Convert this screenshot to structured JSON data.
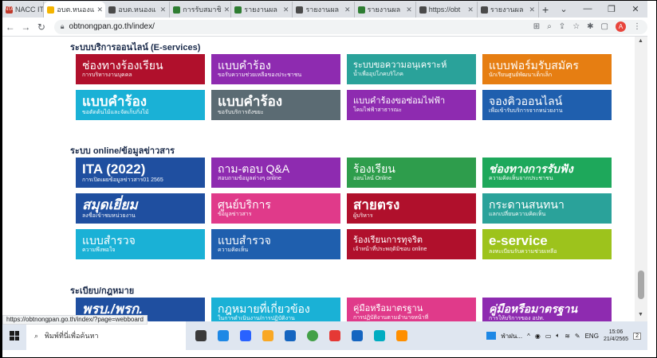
{
  "browser": {
    "tabs": [
      {
        "label": "NACC ITA",
        "favicon_color": "#c0392b",
        "favicon_text": "NTA",
        "active": false
      },
      {
        "label": "อบต.หนองแ",
        "favicon_color": "#f4b400",
        "favicon_text": "",
        "active": true
      },
      {
        "label": "อบต.หนองแ",
        "favicon_color": "#4a4a4a",
        "favicon_text": "",
        "active": false
      },
      {
        "label": "การรับสมาชิ",
        "favicon_color": "#2e7d32",
        "favicon_text": "",
        "active": false
      },
      {
        "label": "รายงานผล",
        "favicon_color": "#2e7d32",
        "favicon_text": "",
        "active": false
      },
      {
        "label": "รายงานผล",
        "favicon_color": "#4a4a4a",
        "favicon_text": "",
        "active": false
      },
      {
        "label": "รายงานผล",
        "favicon_color": "#2e7d32",
        "favicon_text": "",
        "active": false
      },
      {
        "label": "https://obt",
        "favicon_color": "#4a4a4a",
        "favicon_text": "",
        "active": false
      },
      {
        "label": "รายงานผล",
        "favicon_color": "#4a4a4a",
        "favicon_text": "",
        "active": false
      }
    ],
    "url": "obtnongpan.go.th/index/",
    "profile_initial": "A",
    "status_url": "https://obtnongpan.go.th/index/?page=webboard"
  },
  "sections": [
    {
      "title": "ระบบบริการออนไลน์ (E-services)",
      "tiles": [
        {
          "title": "ช่องทางร้องเรียน",
          "subtitle": "การบริหารงานบุคคล",
          "color": "#b0102c",
          "style": ""
        },
        {
          "title": "แบบคำร้อง",
          "subtitle": "ขอรับความช่วยเหลือของประชาชน",
          "color": "#8e2bb0",
          "style": ""
        },
        {
          "title": "ระบบขอความอนุเคราะห์",
          "subtitle": "น้ำเพื่ออุปโภคบริโภค",
          "color": "#2aa29a",
          "style": "small1"
        },
        {
          "title": "แบบฟอร์มรับสมัคร",
          "subtitle": "นักเรียนศูนย์พัฒนาเด็กเล็ก",
          "color": "#e67e12",
          "style": ""
        },
        {
          "title": "แบบคำร้อง",
          "subtitle": "ขอตัดต้นไม้และจัดเก็บกิ่งไม้",
          "color": "#1ab1d6",
          "style": "big"
        },
        {
          "title": "แบบคำร้อง",
          "subtitle": "ขอรับบริการถังขยะ",
          "color": "#5b6b73",
          "style": "big"
        },
        {
          "title": "แบบคำร้องขอซ่อมไฟฟ้า",
          "subtitle": "โคมไฟฟ้าสาธารณะ",
          "color": "#8e2bb0",
          "style": "small1"
        },
        {
          "title": "จองคิวออนไลน์",
          "subtitle": "เพื่อเข้ารับบริการจากหน่วยงาน",
          "color": "#1f5fae",
          "style": ""
        }
      ]
    },
    {
      "title": "ระบบ online/ข้อมูลข่าวสาร",
      "tiles": [
        {
          "title": "ITA (2022)",
          "subtitle": "การเปิดเผยข้อมูลข่าวสาร01 2565",
          "color": "#1f4fa0",
          "style": "big"
        },
        {
          "title": "ถาม-ตอบ Q&A",
          "subtitle": "สอบถามข้อมูลต่างๆ online",
          "color": "#8e2bb0",
          "style": ""
        },
        {
          "title": "ร้องเรียน",
          "subtitle": "ออนไลน์ Online",
          "color": "#2e9d4c",
          "style": ""
        },
        {
          "title": "ช่องทางการรับฟัง",
          "subtitle": "ความคิดเห็นจากประชาชน",
          "color": "#1ea85b",
          "style": "italic"
        },
        {
          "title": "สมุดเยี่ยม",
          "subtitle": "ลงชื่อเข้าชมหน่วยงาน",
          "color": "#1f4fa0",
          "style": "big italic"
        },
        {
          "title": "ศูนย์บริการ",
          "subtitle": "ข้อมูลข่าวสาร",
          "color": "#e03a8a",
          "style": ""
        },
        {
          "title": "สายตรง",
          "subtitle": "ผู้บริหาร",
          "color": "#b0102c",
          "style": "big"
        },
        {
          "title": "กระดานสนทนา",
          "subtitle": "แลกเปลี่ยนความคิดเห็น",
          "color": "#2aa29a",
          "style": ""
        },
        {
          "title": "แบบสำรวจ",
          "subtitle": "ความพึงพอใจ",
          "color": "#1ab1d6",
          "style": ""
        },
        {
          "title": "แบบสำรวจ",
          "subtitle": "ความคิดเห็น",
          "color": "#1f5fae",
          "style": ""
        },
        {
          "title": "ร้องเรียนการทุจริต",
          "subtitle": "เจ้าหน้าที่ประพฤติมิชอบ online",
          "color": "#b0102c",
          "style": "small1"
        },
        {
          "title": "e-service",
          "subtitle": "ลงทะเบียนรับความช่วยเหลือ",
          "color": "#9dc31c",
          "style": "big"
        }
      ]
    },
    {
      "title": "ระเบียบ/กฎหมาย",
      "tiles": [
        {
          "title": "พรบ./พรก.",
          "subtitle": "ที่เกี่ยวข้องกับการปฏิบัติงาน",
          "color": "#1f4fa0",
          "style": "big italic"
        },
        {
          "title": "กฎหมายที่เกี่ยวข้อง",
          "subtitle": "ในการดำเนินงาน/การปฏิบัติงาน",
          "color": "#1ab1d6",
          "style": ""
        },
        {
          "title": "คู่มือหรือมาตรฐาน",
          "subtitle": "การปฏิบัติงานตามอำนาจหน้าที่",
          "color": "#e03a8a",
          "style": "small1"
        },
        {
          "title": "คู่มือหรือมาตรฐาน",
          "subtitle": "การให้บริการของ อปท.",
          "color": "#8e2bb0",
          "style": "italic"
        }
      ]
    }
  ],
  "taskbar": {
    "search_placeholder": "พิมพ์ที่นี่เพื่อค้นหา",
    "weather": "ฟ่าฝน...",
    "lang": "ENG",
    "time": "15:06",
    "date": "21/4/2565",
    "notif_count": "2"
  }
}
